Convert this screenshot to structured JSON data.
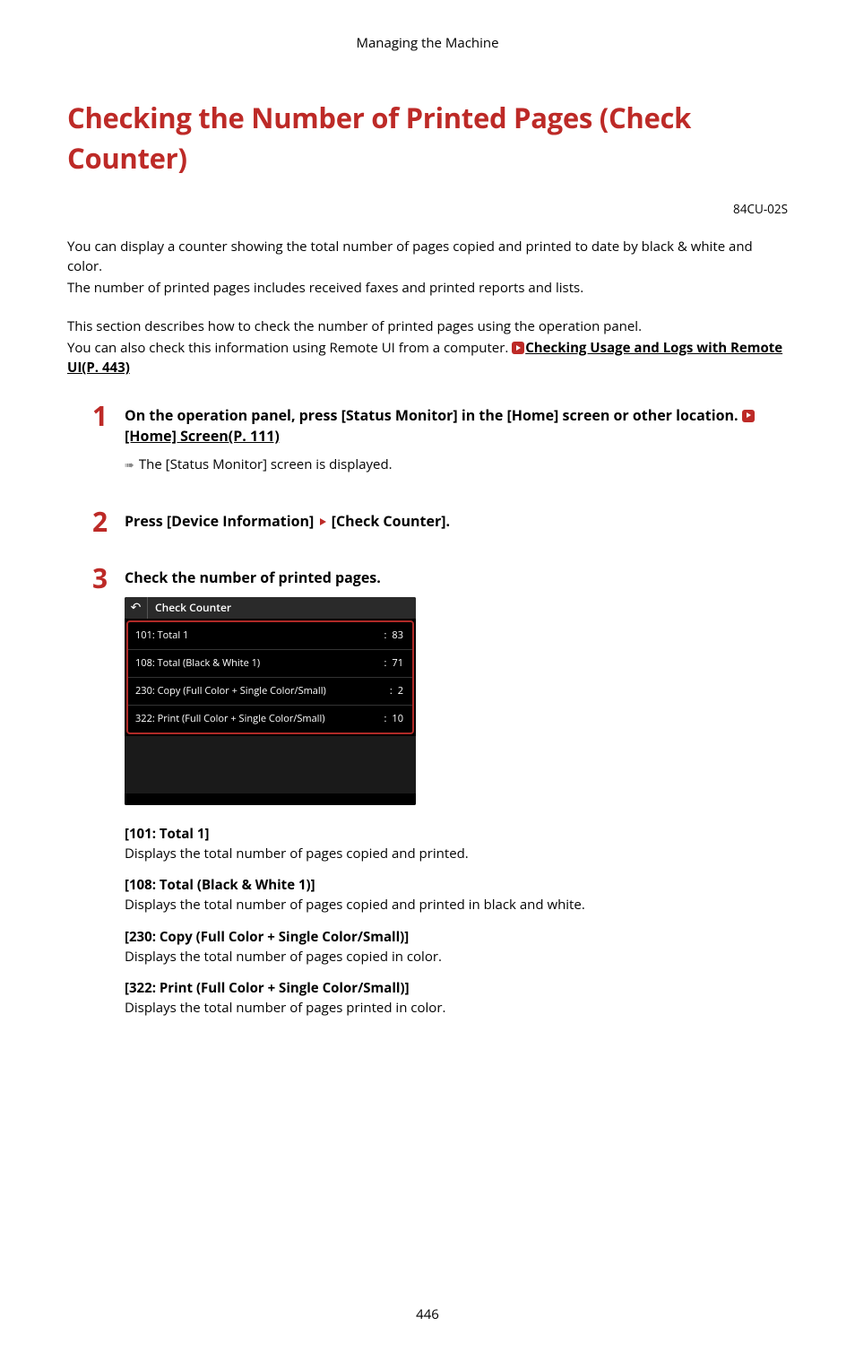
{
  "section_header": "Managing the Machine",
  "title": "Checking the Number of Printed Pages (Check Counter)",
  "doc_code": "84CU-02S",
  "intro": {
    "p1a": "You can display a counter showing the total number of pages copied and printed to date by black & white and color.",
    "p1b": "The number of printed pages includes received faxes and printed reports and lists.",
    "p2a": "This section describes how to check the number of printed pages using the operation panel.",
    "p2b_pre": "You can also check this information using Remote UI from a computer. ",
    "p2b_link": "Checking Usage and Logs with Remote UI(P. 443)"
  },
  "steps": {
    "s1": {
      "num": "1",
      "head_pre": "On the operation panel, press [Status Monitor] in the [Home] screen or other location. ",
      "head_link": "[Home] Screen(P. 111)",
      "note": "The [Status Monitor] screen is displayed."
    },
    "s2": {
      "num": "2",
      "head_a": "Press [Device Information] ",
      "head_b": " [Check Counter]."
    },
    "s3": {
      "num": "3",
      "head": "Check the number of printed pages."
    }
  },
  "device": {
    "title": "Check Counter",
    "rows": [
      {
        "label": "101: Total 1",
        "value": "83"
      },
      {
        "label": "108: Total (Black & White 1)",
        "value": "71"
      },
      {
        "label": "230: Copy (Full Color + Single Color/Small)",
        "value": "2"
      },
      {
        "label": "322: Print (Full Color + Single Color/Small)",
        "value": "10"
      }
    ]
  },
  "defs": [
    {
      "term": "[101: Total 1]",
      "desc": "Displays the total number of pages copied and printed."
    },
    {
      "term": "[108: Total (Black & White 1)]",
      "desc": "Displays the total number of pages copied and printed in black and white."
    },
    {
      "term": "[230: Copy (Full Color + Single Color/Small)]",
      "desc": "Displays the total number of pages copied in color."
    },
    {
      "term": "[322: Print (Full Color + Single Color/Small)]",
      "desc": "Displays the total number of pages printed in color."
    }
  ],
  "page_number": "446"
}
